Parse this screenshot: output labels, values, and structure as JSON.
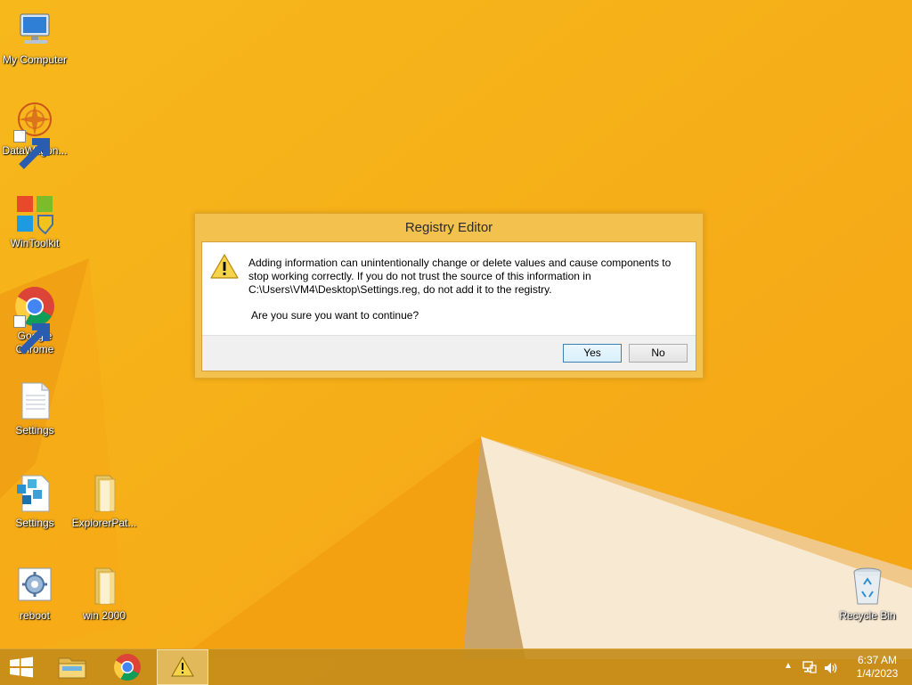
{
  "desktop": {
    "icons": [
      {
        "label": "My Computer",
        "icon": "computer-icon"
      },
      {
        "label": "DataWagon...",
        "icon": "datawagon-icon"
      },
      {
        "label": "WinToolkit",
        "icon": "wintoolkit-icon"
      },
      {
        "label": "Google Chrome",
        "icon": "chrome-icon"
      },
      {
        "label": "Settings",
        "icon": "text-file-icon"
      },
      {
        "label": "Settings",
        "icon": "registry-file-icon"
      },
      {
        "label": "ExplorerPat...",
        "icon": "folder-icon"
      },
      {
        "label": "reboot",
        "icon": "reboot-script-icon"
      },
      {
        "label": "win 2000",
        "icon": "folder-icon"
      },
      {
        "label": "Recycle Bin",
        "icon": "recycle-bin-icon"
      }
    ]
  },
  "dialog": {
    "title": "Registry Editor",
    "icon": "warning-icon",
    "message_lines": [
      "Adding information can unintentionally change or delete values and cause components to",
      "stop working correctly. If you do not trust the source of this information in",
      "C:\\Users\\VM4\\Desktop\\Settings.reg, do not add it to the registry."
    ],
    "question": "Are you sure you want to continue?",
    "buttons": {
      "yes": "Yes",
      "no": "No"
    }
  },
  "taskbar": {
    "items": [
      {
        "icon": "windows-start-icon"
      },
      {
        "icon": "file-explorer-icon"
      },
      {
        "icon": "chrome-icon"
      },
      {
        "icon": "warning-icon",
        "active": true
      }
    ],
    "tray": {
      "time": "6:37 AM",
      "date": "1/4/2023"
    }
  },
  "colors": {
    "wallpaper": "#f6b51c",
    "dialog_frame": "#f2c14e",
    "taskbar": "#c48c1a"
  }
}
